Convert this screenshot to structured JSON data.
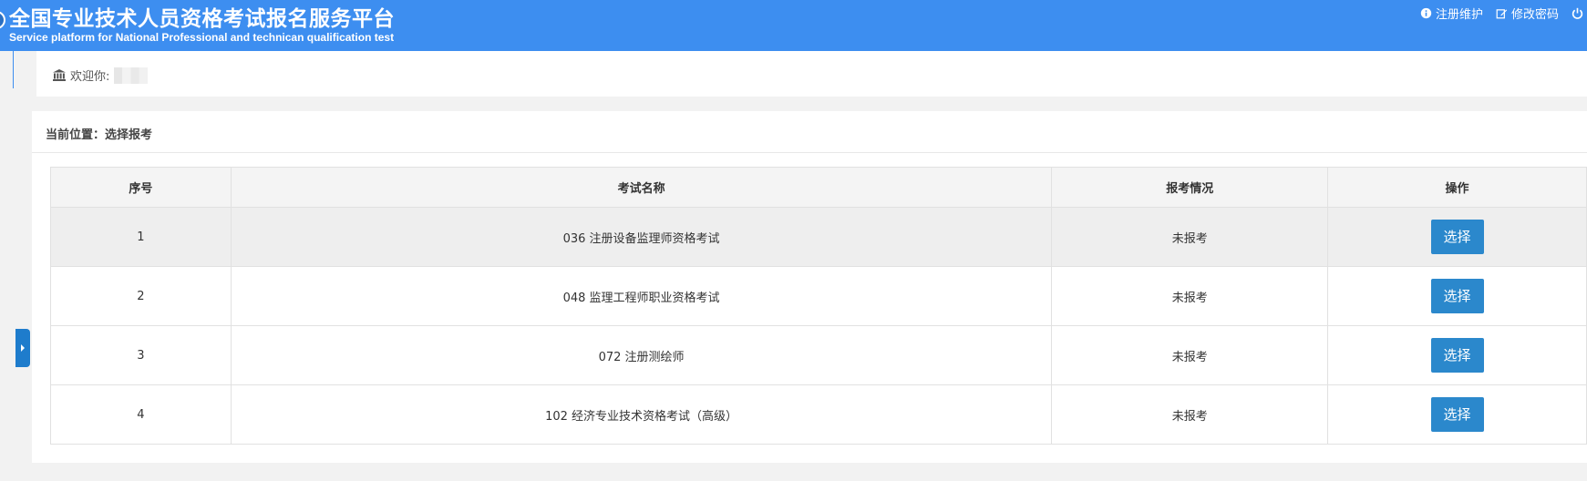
{
  "header": {
    "title_cn": "全国专业技术人员资格考试报名服务平台",
    "title_en": "Service platform for National Professional and technican qualification test",
    "links": {
      "register": "注册维护",
      "password": "修改密码"
    }
  },
  "welcome": {
    "label": "欢迎你:"
  },
  "breadcrumb": {
    "text": "当前位置：选择报考"
  },
  "table": {
    "headers": [
      "序号",
      "考试名称",
      "报考情况",
      "操作"
    ],
    "rows": [
      {
        "no": "1",
        "name": "036 注册设备监理师资格考试",
        "status": "未报考",
        "action": "选择"
      },
      {
        "no": "2",
        "name": "048 监理工程师职业资格考试",
        "status": "未报考",
        "action": "选择"
      },
      {
        "no": "3",
        "name": "072 注册测绘师",
        "status": "未报考",
        "action": "选择"
      },
      {
        "no": "4",
        "name": "102 经济专业技术资格考试（高级）",
        "status": "未报考",
        "action": "选择"
      }
    ]
  },
  "colors": {
    "header_bg": "#3d8ef0",
    "button_bg": "#2b88cc",
    "side_toggle": "#1e7ccc"
  },
  "icons": {
    "register": "info-icon",
    "password": "edit-icon",
    "logout": "power-icon",
    "welcome": "bank-icon"
  }
}
